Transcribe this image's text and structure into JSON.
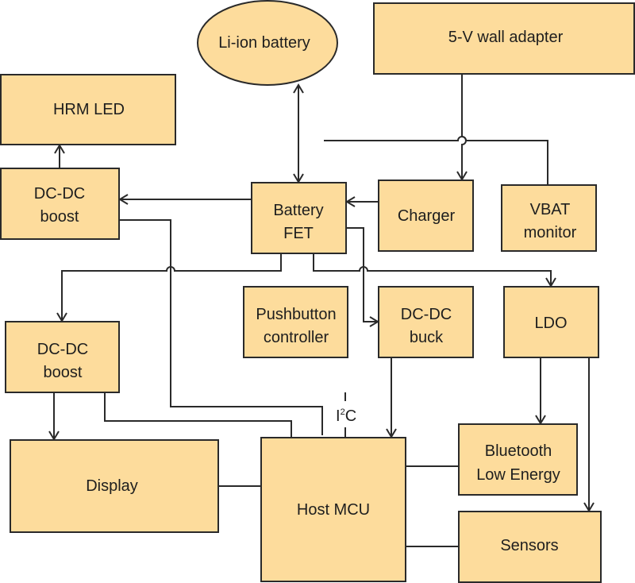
{
  "diagram": {
    "type": "block-diagram",
    "colors": {
      "block_fill": "#fddc9c",
      "line": "#2a2a2a",
      "text": "#1e1e1e"
    },
    "blocks": {
      "battery": {
        "lines": [
          "Li-ion battery"
        ],
        "shape": "ellipse"
      },
      "wall_adapter": {
        "lines": [
          "5-V wall adapter"
        ]
      },
      "hrm_led": {
        "lines": [
          "HRM LED"
        ]
      },
      "boost_top": {
        "lines": [
          "DC-DC",
          "boost"
        ]
      },
      "battery_fet": {
        "lines": [
          "Battery",
          "FET"
        ]
      },
      "charger": {
        "lines": [
          "Charger"
        ]
      },
      "vbat_monitor": {
        "lines": [
          "VBAT",
          "monitor"
        ]
      },
      "boost_left": {
        "lines": [
          "DC-DC",
          "boost"
        ]
      },
      "pushbutton": {
        "lines": [
          "Pushbutton",
          "controller"
        ]
      },
      "buck": {
        "lines": [
          "DC-DC",
          "buck"
        ]
      },
      "ldo": {
        "lines": [
          "LDO"
        ]
      },
      "display": {
        "lines": [
          "Display"
        ]
      },
      "host_mcu": {
        "lines": [
          "Host MCU"
        ]
      },
      "ble": {
        "lines": [
          "Bluetooth",
          "Low Energy"
        ]
      },
      "sensors": {
        "lines": [
          "Sensors"
        ]
      }
    },
    "bus_label": {
      "base": "I",
      "sup": "2",
      "rest": "C"
    },
    "connections": [
      {
        "from": "battery",
        "to": "battery_fet",
        "bidirectional": true
      },
      {
        "from": "wall_adapter",
        "to": "charger"
      },
      {
        "from": "wall_adapter",
        "to": "vbat_monitor"
      },
      {
        "from": "charger",
        "to": "battery_fet"
      },
      {
        "from": "battery_fet",
        "to": "boost_top"
      },
      {
        "from": "boost_top",
        "to": "hrm_led"
      },
      {
        "from": "battery_fet",
        "to": "boost_left"
      },
      {
        "from": "battery_fet",
        "to": "buck"
      },
      {
        "from": "battery_fet",
        "to": "ldo"
      },
      {
        "from": "boost_left",
        "to": "display"
      },
      {
        "from": "buck",
        "to": "host_mcu"
      },
      {
        "from": "ldo",
        "to": "ble"
      },
      {
        "from": "ldo",
        "to": "sensors"
      },
      {
        "from": "host_mcu",
        "to": "display",
        "arrow": false
      },
      {
        "from": "host_mcu",
        "to": "ble",
        "arrow": false
      },
      {
        "from": "host_mcu",
        "to": "sensors",
        "arrow": false
      },
      {
        "from": "host_mcu",
        "to": "boost_top",
        "arrow": false
      },
      {
        "from": "host_mcu",
        "to": "boost_left",
        "arrow": false
      }
    ]
  }
}
